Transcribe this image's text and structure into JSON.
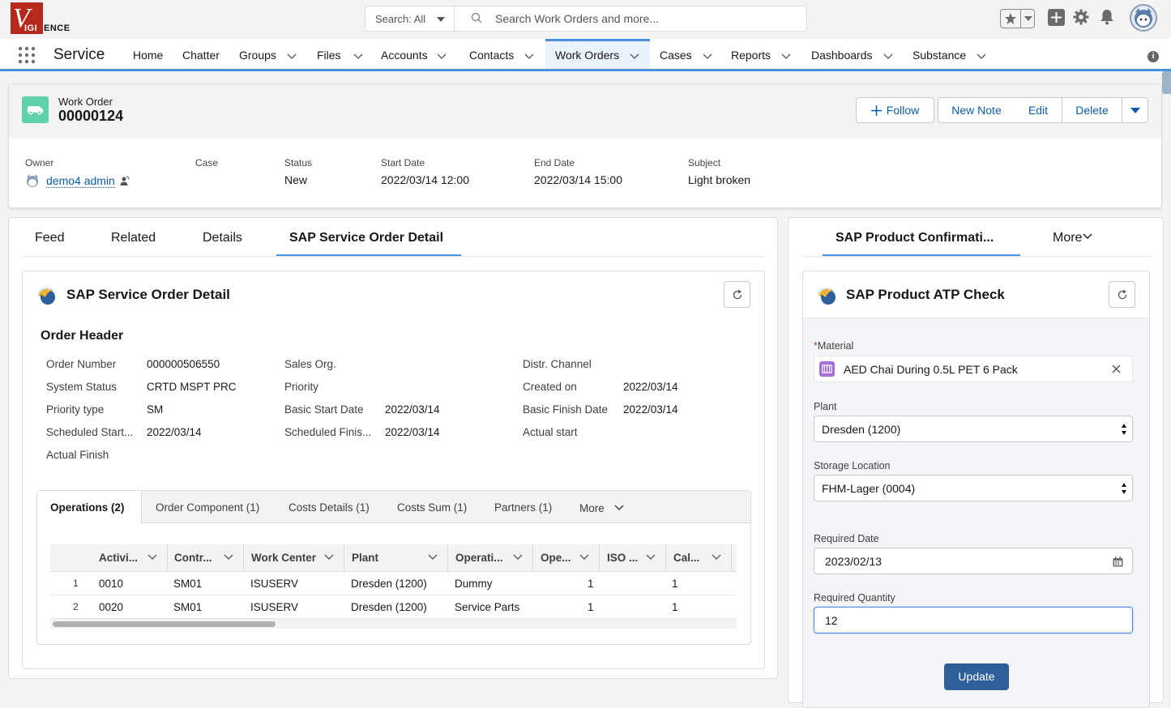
{
  "header": {
    "logo": {
      "v": "V",
      "igi": "IGI",
      "ence": "ENCE"
    },
    "search": {
      "scope": "Search: All",
      "placeholder": "Search Work Orders and more..."
    },
    "icons": [
      "favorites-star-icon",
      "add-icon",
      "setup-gear-icon",
      "notifications-bell-icon",
      "user-avatar"
    ]
  },
  "nav": {
    "app_name": "Service",
    "items": [
      {
        "label": "Home",
        "has_menu": false
      },
      {
        "label": "Chatter",
        "has_menu": false
      },
      {
        "label": "Groups",
        "has_menu": true
      },
      {
        "label": "Files",
        "has_menu": true
      },
      {
        "label": "Accounts",
        "has_menu": true
      },
      {
        "label": "Contacts",
        "has_menu": true
      },
      {
        "label": "Work Orders",
        "has_menu": true,
        "active": true
      },
      {
        "label": "Cases",
        "has_menu": true
      },
      {
        "label": "Reports",
        "has_menu": true
      },
      {
        "label": "Dashboards",
        "has_menu": true
      },
      {
        "label": "Substance",
        "has_menu": true
      }
    ]
  },
  "record": {
    "object_type": "Work Order",
    "id": "00000124",
    "actions": {
      "follow": "Follow",
      "new_note": "New Note",
      "edit": "Edit",
      "delete": "Delete"
    },
    "highlights": {
      "owner_label": "Owner",
      "owner_value": "demo4 admin",
      "case_label": "Case",
      "case_value": "",
      "status_label": "Status",
      "status_value": "New",
      "start_label": "Start Date",
      "start_value": "2022/03/14 12:00",
      "end_label": "End Date",
      "end_value": "2022/03/14 15:00",
      "subject_label": "Subject",
      "subject_value": "Light broken"
    }
  },
  "left_tabs": [
    "Feed",
    "Related",
    "Details",
    "SAP Service Order Detail"
  ],
  "service_order": {
    "card_title": "SAP Service Order Detail",
    "section_title": "Order Header",
    "fields": [
      {
        "label": "Order Number",
        "value": "000000506550"
      },
      {
        "label": "Sales Org.",
        "value": ""
      },
      {
        "label": "Distr. Channel",
        "value": ""
      },
      {
        "label": "System Status",
        "value": "CRTD MSPT PRC"
      },
      {
        "label": "Priority",
        "value": ""
      },
      {
        "label": "Created on",
        "value": "2022/03/14"
      },
      {
        "label": "Priority type",
        "value": "SM"
      },
      {
        "label": "Basic Start Date",
        "value": "2022/03/14"
      },
      {
        "label": "Basic Finish Date",
        "value": "2022/03/14"
      },
      {
        "label": "Scheduled Start...",
        "value": "2022/03/14"
      },
      {
        "label": "Scheduled Finis...",
        "value": "2022/03/14"
      },
      {
        "label": "Actual start",
        "value": ""
      },
      {
        "label": "Actual Finish",
        "value": ""
      }
    ],
    "sub_tabs": [
      "Operations (2)",
      "Order Component (1)",
      "Costs Details (1)",
      "Costs Sum (1)",
      "Partners (1)",
      "More"
    ],
    "table": {
      "columns": [
        "Activi...",
        "Contr...",
        "Work Center",
        "Plant",
        "Operati...",
        "Ope...",
        "ISO ...",
        "Cal..."
      ],
      "rows": [
        {
          "num": "1",
          "cells": [
            "0010",
            "SM01",
            "ISUSERV",
            "Dresden (1200)",
            "Dummy",
            "1",
            "",
            "1"
          ]
        },
        {
          "num": "2",
          "cells": [
            "0020",
            "SM01",
            "ISUSERV",
            "Dresden (1200)",
            "Service Parts",
            "1",
            "",
            "1"
          ]
        }
      ]
    }
  },
  "right_tabs": {
    "active": "SAP Product Confirmati...",
    "more": "More"
  },
  "atp": {
    "card_title": "SAP Product ATP Check",
    "material_label": "Material",
    "material_value": "AED Chai During 0.5L PET 6 Pack",
    "plant_label": "Plant",
    "plant_value": "Dresden (1200)",
    "storage_label": "Storage Location",
    "storage_value": "FHM-Lager (0004)",
    "date_label": "Required Date",
    "date_value": "2023/02/13",
    "qty_label": "Required Quantity",
    "qty_value": "12",
    "update_label": "Update"
  },
  "colors": {
    "brand_blue": "#4a90e2",
    "button_text": "#0b5cab",
    "update_button": "#2e5f99",
    "work_order_icon": "#5fd1aa",
    "logo_red": "#b7281d"
  }
}
